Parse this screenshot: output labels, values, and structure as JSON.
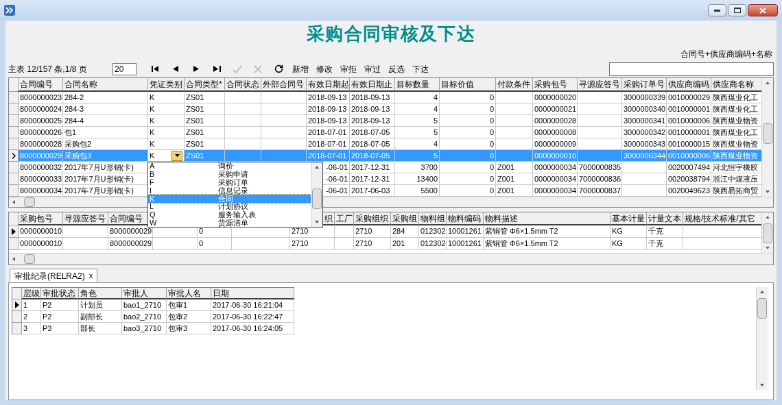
{
  "title": "采购合同审核及下达",
  "search": {
    "label": "合同号+供应商编码+名称"
  },
  "toolbar": {
    "status": "主表 12/157 条,1/8 页",
    "page_size": "20",
    "nav_buttons": [
      {
        "kind": "first",
        "disabled": false
      },
      {
        "kind": "prev",
        "disabled": false
      },
      {
        "kind": "next",
        "disabled": false
      },
      {
        "kind": "last",
        "disabled": false
      },
      {
        "kind": "confirm",
        "disabled": true
      },
      {
        "kind": "cancel",
        "disabled": true
      },
      {
        "kind": "refresh",
        "disabled": false
      }
    ],
    "actions": [
      "新增",
      "修改",
      "审拒",
      "审过",
      "反选",
      "下达"
    ]
  },
  "main_table": {
    "columns": [
      {
        "label": "合同编号",
        "kind": "text"
      },
      {
        "label": "合同名称",
        "kind": "text"
      },
      {
        "label": "凭证类别",
        "kind": "dropdown"
      },
      {
        "label": "合同类型*",
        "kind": "text"
      },
      {
        "label": "合同状态",
        "kind": "text"
      },
      {
        "label": "外部合同号",
        "kind": "text"
      },
      {
        "label": "有效日期起",
        "kind": "text"
      },
      {
        "label": "有效日期止",
        "kind": "text"
      },
      {
        "label": "目标数量",
        "kind": "number"
      },
      {
        "label": "目标价值",
        "kind": "number"
      },
      {
        "label": "付款条件",
        "kind": "text"
      },
      {
        "label": "采购包号",
        "kind": "text"
      },
      {
        "label": "寻源应答号",
        "kind": "text"
      },
      {
        "label": "采购订单号",
        "kind": "text"
      },
      {
        "label": "供应商编码",
        "kind": "text"
      },
      {
        "label": "供应商名称",
        "kind": "text"
      }
    ],
    "rows": [
      {
        "selected": false,
        "cells": [
          "8000000023",
          "284-2",
          "K",
          "ZS01",
          null,
          null,
          "2018-09-13",
          "2018-09-13",
          "4",
          "0",
          null,
          "0000000020",
          null,
          "3000000339",
          "0010000029",
          "陕西煤业化工"
        ]
      },
      {
        "selected": false,
        "cells": [
          "8000000024",
          "284-3",
          "K",
          "ZS01",
          null,
          null,
          "2018-09-13",
          "2018-09-13",
          "4",
          "0",
          null,
          "0000000021",
          null,
          "3000000340",
          "0010000001",
          "陕西煤业化工"
        ]
      },
      {
        "selected": false,
        "cells": [
          "8000000025",
          "284-4",
          "K",
          "ZS01",
          null,
          null,
          "2018-09-13",
          "2018-09-13",
          "5",
          "0",
          null,
          "0000000028",
          null,
          "3000000341",
          "0010000006",
          "陕西煤业物资"
        ]
      },
      {
        "selected": false,
        "cells": [
          "8000000026",
          "包1",
          "K",
          "ZS01",
          null,
          null,
          "2018-07-01",
          "2018-07-05",
          "5",
          "0",
          null,
          "0000000008",
          null,
          "3000000342",
          "0010000001",
          "陕西煤业化工"
        ]
      },
      {
        "selected": false,
        "cells": [
          "8000000028",
          "采购包2",
          "K",
          "ZS01",
          null,
          null,
          "2018-07-01",
          "2018-07-05",
          "4",
          "0",
          null,
          "0000000009",
          null,
          "3000000343",
          "0010000015",
          "陕西煤业物资"
        ]
      },
      {
        "selected": true,
        "cells": [
          "8000000029",
          "采购包3",
          "K",
          "ZS01",
          null,
          null,
          "2018-07-01",
          "2018-07-05",
          "5",
          "0",
          null,
          "0000000010",
          null,
          "3000000344",
          "0010000006",
          "陕西煤业物资"
        ]
      },
      {
        "selected": false,
        "cells": [
          "8000000032",
          "2017年7月U形销(卡)",
          null,
          null,
          null,
          null,
          "-06-01",
          "2017-12-31",
          "3700",
          "0",
          "Z001",
          "0000000034",
          "7000000835",
          null,
          "0020007494",
          "河北恒宇橡胶"
        ]
      },
      {
        "selected": false,
        "cells": [
          "8000000033",
          "2017年7月U形销(卡)",
          null,
          null,
          null,
          null,
          "-06-01",
          "2017-12-31",
          "13400",
          "0",
          "Z001",
          "0000000034",
          "7000000836",
          null,
          "0020038794",
          "浙江中煤液压"
        ]
      },
      {
        "selected": false,
        "cells": [
          "8000000034",
          "2017年7月U形销(卡)",
          null,
          null,
          null,
          null,
          "-06-01",
          "2017-06-03",
          "5500",
          "0",
          "Z001",
          "0000000034",
          "7000000837",
          null,
          "0020049623",
          "陕西易拓商贸"
        ]
      }
    ]
  },
  "dropdown": {
    "items": [
      {
        "code": "A",
        "label": "询价",
        "selected": false
      },
      {
        "code": "B",
        "label": "采购申请",
        "selected": false
      },
      {
        "code": "F",
        "label": "采购订单",
        "selected": false
      },
      {
        "code": "I",
        "label": "信息记录",
        "selected": false
      },
      {
        "code": "K",
        "label": "合同",
        "selected": true
      },
      {
        "code": "L",
        "label": "计划协议",
        "selected": false
      },
      {
        "code": "Q",
        "label": "服务输入表",
        "selected": false
      },
      {
        "code": "W",
        "label": "货源清单",
        "selected": false
      }
    ]
  },
  "detail_table": {
    "columns": [
      {
        "label": "采购包号"
      },
      {
        "label": "寻源应答号"
      },
      {
        "label": "合同编号"
      },
      {},
      {},
      {},
      {
        "label": "织",
        "partial": true
      },
      {
        "label": "工厂"
      },
      {
        "label": "采购组织"
      },
      {
        "label": "采购组"
      },
      {
        "label": "物料组"
      },
      {
        "label": "物料编码"
      },
      {
        "label": "物料描述"
      },
      {
        "label": "基本计量"
      },
      {
        "label": "计量文本"
      },
      {
        "label": "规格/技术标准/其它"
      }
    ],
    "rows": [
      {
        "current": true,
        "cells": [
          "0000000010",
          null,
          "8000000029",
          null,
          "0",
          null,
          "2710",
          null,
          "2710",
          "284",
          "012302",
          "10001261",
          "紫铜管 Φ6×1.5mm T2",
          "KG",
          "千克",
          null
        ]
      },
      {
        "current": false,
        "cells": [
          "0000000010",
          null,
          "8000000029",
          null,
          "0",
          null,
          "2710",
          null,
          "2710",
          "201",
          "012302",
          "10001261",
          "紫铜管 Φ6×1.5mm T2",
          "KG",
          "千克",
          null
        ]
      }
    ]
  },
  "tabs": [
    {
      "label": "审批纪录(RELRA2)",
      "close": "x",
      "selected": true
    }
  ],
  "approval_table": {
    "columns": [
      "层级",
      "审批状态",
      "角色",
      "审批人",
      "审批人名",
      "日期"
    ],
    "rows": [
      {
        "current": true,
        "cells": [
          "1",
          "P2",
          "计划员",
          "bao1_2710",
          "包审1",
          "2017-06-30 16:21:04"
        ]
      },
      {
        "current": false,
        "cells": [
          "2",
          "P2",
          "副部长",
          "bao2_2710",
          "包审2",
          "2017-06-30 16:22:47"
        ]
      },
      {
        "current": false,
        "cells": [
          "3",
          "P3",
          "部长",
          "bao3_2710",
          "包审3",
          "2017-06-30 16:24:05"
        ]
      }
    ]
  }
}
